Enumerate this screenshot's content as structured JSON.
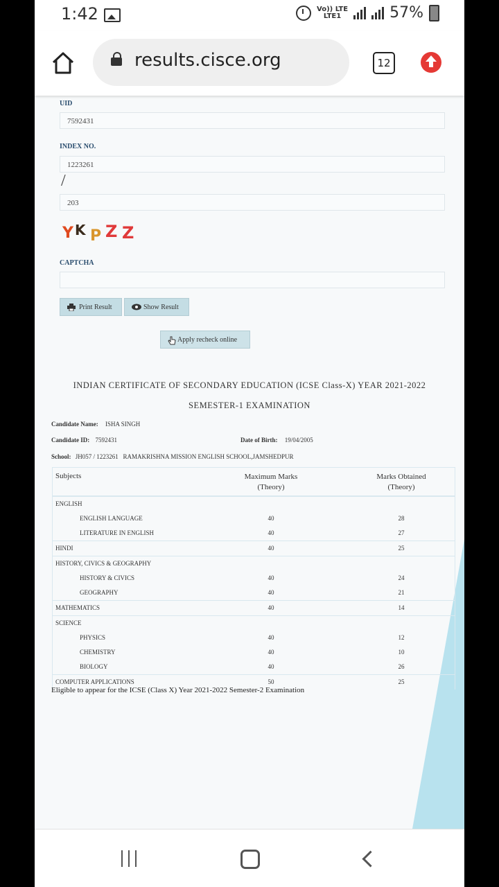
{
  "status_bar": {
    "time": "1:42",
    "network_top": "Vo)) LTE",
    "network_bottom": "LTE1",
    "battery": "57%"
  },
  "browser": {
    "url": "results.cisce.org",
    "tab_count": "12"
  },
  "form": {
    "uid_label": "UID",
    "uid_value": "7592431",
    "index_label": "INDEX NO.",
    "index_value_1": "1223261",
    "index_separator": "/",
    "index_value_2": "203",
    "captcha_text": "YKPZZ",
    "captcha_label": "CAPTCHA",
    "captcha_value": "",
    "print_button": "Print Result",
    "show_button": "Show Result",
    "recheck_button": "Apply recheck online"
  },
  "result": {
    "heading": "INDIAN CERTIFICATE OF SECONDARY EDUCATION (ICSE Class-X) YEAR 2021-2022",
    "subheading": "SEMESTER-1 EXAMINATION",
    "candidate_name_label": "Candidate Name:",
    "candidate_name": "ISHA SINGH",
    "candidate_id_label": "Candidate ID:",
    "candidate_id": "7592431",
    "dob_label": "Date of Birth:",
    "dob": "19/04/2005",
    "school_label": "School:",
    "school": "JH057 / 1223261   RAMAKRISHNA MISSION ENGLISH SCHOOL,JAMSHEDPUR",
    "table_headers": {
      "subjects": "Subjects",
      "max_marks": "Maximum Marks",
      "max_marks_sub": "(Theory)",
      "obtained": "Marks Obtained",
      "obtained_sub": "(Theory)"
    },
    "rows": [
      {
        "subject": "ENGLISH",
        "max": "",
        "obtained": "",
        "sub": false,
        "group_start": true
      },
      {
        "subject": "ENGLISH LANGUAGE",
        "max": "40",
        "obtained": "28",
        "sub": true,
        "group_start": false
      },
      {
        "subject": "LITERATURE IN ENGLISH",
        "max": "40",
        "obtained": "27",
        "sub": true,
        "group_start": false
      },
      {
        "subject": "HINDI",
        "max": "40",
        "obtained": "25",
        "sub": false,
        "group_start": true
      },
      {
        "subject": "HISTORY, CIVICS & GEOGRAPHY",
        "max": "",
        "obtained": "",
        "sub": false,
        "group_start": true
      },
      {
        "subject": "HISTORY & CIVICS",
        "max": "40",
        "obtained": "24",
        "sub": true,
        "group_start": false
      },
      {
        "subject": "GEOGRAPHY",
        "max": "40",
        "obtained": "21",
        "sub": true,
        "group_start": false
      },
      {
        "subject": "MATHEMATICS",
        "max": "40",
        "obtained": "14",
        "sub": false,
        "group_start": true
      },
      {
        "subject": "SCIENCE",
        "max": "",
        "obtained": "",
        "sub": false,
        "group_start": true
      },
      {
        "subject": "PHYSICS",
        "max": "40",
        "obtained": "12",
        "sub": true,
        "group_start": false
      },
      {
        "subject": "CHEMISTRY",
        "max": "40",
        "obtained": "10",
        "sub": true,
        "group_start": false
      },
      {
        "subject": "BIOLOGY",
        "max": "40",
        "obtained": "26",
        "sub": true,
        "group_start": false
      },
      {
        "subject": "COMPUTER APPLICATIONS",
        "max": "50",
        "obtained": "25",
        "sub": false,
        "group_start": true
      }
    ],
    "eligibility": "Eligible to appear for the ICSE (Class X) Year 2021-2022 Semester-2 Examination"
  },
  "colors": {
    "accent_blue": "#c4dde4",
    "update_red": "#e53935",
    "deco_light_blue": "#b8e2ee",
    "label_blue": "#2a4d6e"
  }
}
